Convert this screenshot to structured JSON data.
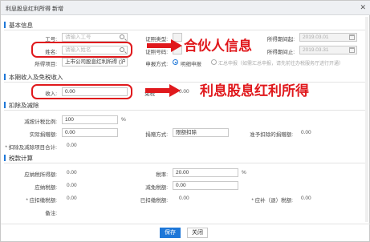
{
  "window": {
    "title": "利息股息红利所得 新增",
    "close": "✕"
  },
  "basic": {
    "section_title": "基本信息",
    "work_id_label": "工号:",
    "work_id_placeholder": "请输入工号",
    "name_label": "姓名:",
    "name_placeholder": "请输入姓名",
    "project_label": "所得项目:",
    "project_value": "上市公司股息红利所得 (沪",
    "cert_type_label": "证照类型:",
    "cert_no_label": "证照号码:",
    "period_start_label": "所得期间起:",
    "period_start_value": "2019.03.01",
    "period_end_label": "所得期间止:",
    "period_end_value": "2019.03.31",
    "declare_label": "申报方式:",
    "declare_option_1": "明细申报",
    "declare_option_2": "汇总申报（如需汇总申报，请先前往办税服务厅进行开通）"
  },
  "income": {
    "section_title": "本期收入及免税收入",
    "income_label": "收入:",
    "income_value": "0.00",
    "exempt_label": "免税",
    "exempt_value": "0.00"
  },
  "deduction": {
    "section_title": "扣除及减除",
    "reduce_ratio_label": "减按计税比例:",
    "reduce_ratio_value": "100",
    "reduce_ratio_unit": "%",
    "donation_actual_label": "实际捐赠额:",
    "donation_actual_value": "0.00",
    "donation_method_label": "捐赠方式:",
    "donation_method_value": "限额扣除",
    "donation_allowed_label": "准予扣除的捐赠额:",
    "donation_allowed_value": "0.00",
    "total_label": "* 扣除及减除项目合计:",
    "total_value": "0.00"
  },
  "tax": {
    "section_title": "税款计算",
    "taxable_income_label": "应纳税所得额:",
    "taxable_income_value": "0.00",
    "rate_label": "税率:",
    "rate_value": "20.00",
    "rate_unit": "%",
    "tax_payable_label": "应纳税额:",
    "tax_payable_value": "0.00",
    "relief_label": "减免税额:",
    "relief_value": "0.00",
    "tax_due_label": "* 应扣缴税额:",
    "tax_due_value": "0.00",
    "prepaid_label": "已扣缴税额:",
    "prepaid_value": "0.00",
    "refund_label": "* 应补（退）税额:",
    "refund_value": "0.00",
    "remark_label": "备注:"
  },
  "annotations": {
    "partner_info": "合伙人信息",
    "dividend_income": "利息股息红利所得",
    "color": "#e0191d"
  },
  "buttons": {
    "save": "保存",
    "close": "关闭"
  },
  "colors": {
    "accent": "#1e77d8",
    "annotation_red": "#e0191d"
  }
}
